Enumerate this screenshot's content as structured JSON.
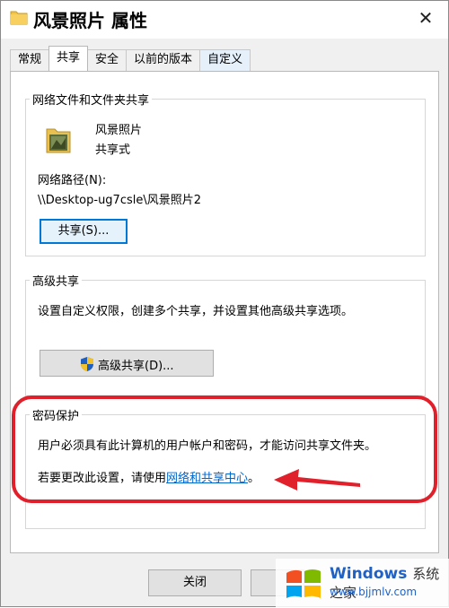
{
  "window": {
    "title": "风景照片 属性",
    "close_glyph": "✕"
  },
  "tabs": [
    {
      "label": "常规",
      "active": false
    },
    {
      "label": "共享",
      "active": true
    },
    {
      "label": "安全",
      "active": false
    },
    {
      "label": "以前的版本",
      "active": false
    },
    {
      "label": "自定义",
      "active": false
    }
  ],
  "network_share": {
    "group_title": "网络文件和文件夹共享",
    "folder_name": "风景照片",
    "share_status": "共享式",
    "path_label": "网络路径(N):",
    "path_value": "\\\\Desktop-ug7csle\\风景照片2",
    "share_button": "共享(S)..."
  },
  "advanced_share": {
    "group_title": "高级共享",
    "description": "设置自定义权限，创建多个共享，并设置其他高级共享选项。",
    "button": "高级共享(D)..."
  },
  "password_protection": {
    "group_title": "密码保护",
    "description": "用户必须具有此计算机的用户帐户和密码，才能访问共享文件夹。",
    "change_prefix": "若要更改此设置，请使用",
    "link": "网络和共享中心",
    "change_suffix": "。"
  },
  "footer": {
    "close_button": "关闭"
  },
  "watermark": {
    "brand": "Windows",
    "brand_suffix": "系统之家",
    "url": "www.bjjmlv.com"
  },
  "colors": {
    "accent": "#0078d7",
    "callout": "#e0202a",
    "link": "#0066cc"
  }
}
